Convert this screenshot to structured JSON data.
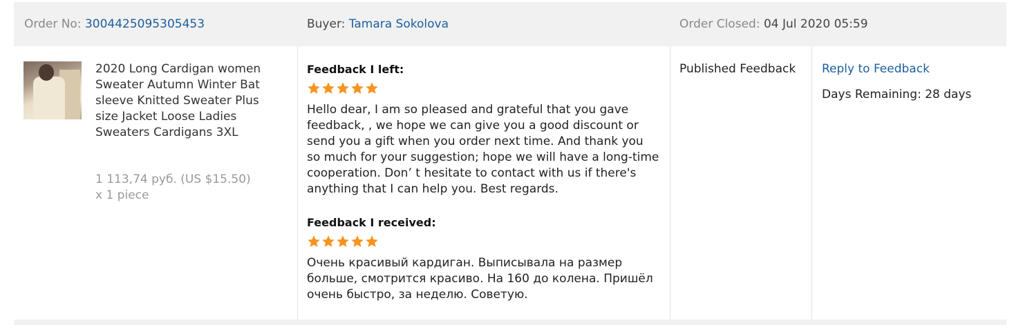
{
  "order": {
    "number_label": "Order No:",
    "number": "3004425095305453",
    "buyer_label": "Buyer:",
    "buyer": "Tamara Sokolova",
    "closed_label": "Order Closed:",
    "closed_date": "04 Jul 2020 05:59"
  },
  "product": {
    "title": "2020 Long Cardigan women Sweater Autumn Winter Bat sleeve Knitted Sweater Plus size Jacket Loose Ladies Sweaters Cardigans 3XL",
    "price": "1 113,74 руб. (US $15.50)",
    "quantity": "x 1 piece"
  },
  "feedback_left": {
    "heading": "Feedback I left:",
    "rating": 5,
    "text": "Hello dear, I am so pleased and grateful that you gave feedback, , we hope we can give you a good discount or send you a gift when you order next time. And thank you so much for your suggestion; hope we will have a long-time cooperation. Don’ t hesitate to contact with us if there's anything that I can help you. Best regards."
  },
  "feedback_received": {
    "heading": "Feedback I received:",
    "rating": 5,
    "text": "Очень красивый кардиган. Выписывала на размер больше, смотрится красиво. На 160 до колена. Пришёл очень быстро, за неделю. Советую."
  },
  "status": "Published Feedback",
  "actions": {
    "reply_label": "Reply to Feedback",
    "days_remaining": "Days Remaining: 28 days"
  },
  "colors": {
    "link": "#1a5f9e",
    "star": "#f7931e",
    "header_bg": "#f1f1f1"
  }
}
